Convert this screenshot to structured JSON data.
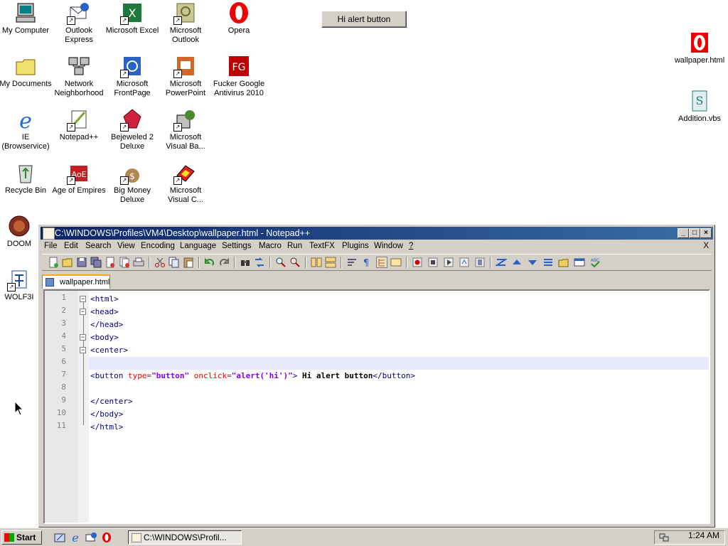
{
  "desktop": {
    "icons_left": [
      {
        "label": "My Computer",
        "icon": "computer-icon"
      },
      {
        "label": "Outlook Express",
        "icon": "outlook-express-icon"
      },
      {
        "label": "Microsoft Excel",
        "icon": "excel-icon"
      },
      {
        "label": "Microsoft Outlook",
        "icon": "outlook-icon"
      },
      {
        "label": "Opera",
        "icon": "opera-icon"
      },
      {
        "label": "My Documents",
        "icon": "folder-icon"
      },
      {
        "label": "Network Neighborhood",
        "icon": "network-icon"
      },
      {
        "label": "Microsoft FrontPage",
        "icon": "frontpage-icon"
      },
      {
        "label": "Microsoft PowerPoint",
        "icon": "powerpoint-icon"
      },
      {
        "label": "Fucker Google Antivirus 2010",
        "icon": "antivirus-icon"
      },
      {
        "label": "IE (Browservice)",
        "icon": "ie-icon"
      },
      {
        "label": "Notepad++",
        "icon": "notepadpp-icon"
      },
      {
        "label": "Bejeweled 2 Deluxe",
        "icon": "bejeweled-icon"
      },
      {
        "label": "Microsoft Visual Ba...",
        "icon": "visual-basic-icon"
      },
      {
        "label": "Recycle Bin",
        "icon": "recycle-bin-icon"
      },
      {
        "label": "Age of Empires",
        "icon": "age-of-empires-icon"
      },
      {
        "label": "Big Money Deluxe",
        "icon": "big-money-icon"
      },
      {
        "label": "Microsoft Visual C...",
        "icon": "visual-c-icon"
      },
      {
        "label": "DOOM",
        "icon": "doom-icon"
      },
      {
        "label": "WOLF3I",
        "icon": "wolf3d-icon"
      }
    ],
    "icons_right": [
      {
        "label": "wallpaper.html",
        "icon": "opera-html-icon"
      },
      {
        "label": "Addition.vbs",
        "icon": "vbs-script-icon"
      }
    ],
    "wallpaper_button_label": "Hi alert button"
  },
  "window": {
    "title": "C:\\WINDOWS\\Profiles\\VM4\\Desktop\\wallpaper.html - Notepad++",
    "menu": [
      "File",
      "Edit",
      "Search",
      "View",
      "Encoding",
      "Language",
      "Settings",
      "Macro",
      "Run",
      "TextFX",
      "Plugins",
      "Window",
      "?"
    ],
    "menu_close": "X",
    "tab_label": "wallpaper.html",
    "lines": [
      {
        "n": "1",
        "a": "<html>"
      },
      {
        "n": "2",
        "a": "<head>"
      },
      {
        "n": "3",
        "a": "</head>"
      },
      {
        "n": "4",
        "a": "<body>"
      },
      {
        "n": "5",
        "a": "<center>"
      },
      {
        "n": "6",
        "a": ""
      },
      {
        "n": "7",
        "a": "<button ",
        "b": "type=",
        "c": "\"button\"",
        "d": " onclick=",
        "e": "\"alert('hi')\"",
        "f": "> ",
        "g": "Hi alert button",
        "h": "</button>"
      },
      {
        "n": "8",
        "a": ""
      },
      {
        "n": "9",
        "a": "</center>"
      },
      {
        "n": "10",
        "a": "</body>"
      },
      {
        "n": "11",
        "a": "</html>"
      }
    ]
  },
  "taskbar": {
    "start_label": "Start",
    "task_label": "C:\\WINDOWS\\Profil...",
    "clock": "1:24 AM"
  }
}
